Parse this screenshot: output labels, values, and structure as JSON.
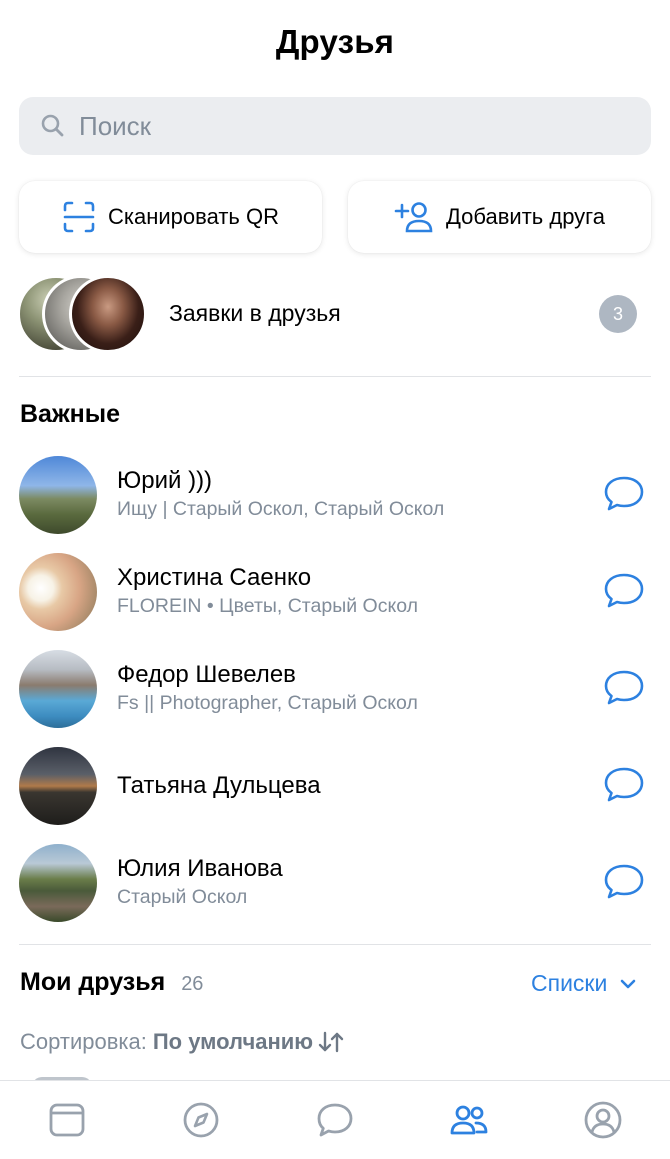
{
  "header": {
    "title": "Друзья"
  },
  "search": {
    "placeholder": "Поиск"
  },
  "actions": {
    "scan_qr": "Сканировать QR",
    "add_friend": "Добавить друга"
  },
  "requests": {
    "label": "Заявки в друзья",
    "count": "3"
  },
  "important": {
    "title": "Важные",
    "friends": [
      {
        "name": "Юрий )))",
        "subtitle": "Ищу | Старый Оскол, Старый Оскол"
      },
      {
        "name": "Христина Саенко",
        "subtitle": "FLOREIN • Цветы, Старый Оскол"
      },
      {
        "name": "Федор Шевелев",
        "subtitle": "Fs || Photographer, Старый Оскол"
      },
      {
        "name": "Татьяна Дульцева",
        "subtitle": ""
      },
      {
        "name": "Юлия Иванова",
        "subtitle": "Старый Оскол"
      }
    ]
  },
  "my_friends": {
    "title": "Мои друзья",
    "count": "26",
    "lists_label": "Списки"
  },
  "sort": {
    "label": "Сортировка:",
    "value": "По умолчанию"
  },
  "colors": {
    "accent": "#2d81e0",
    "secondary_text": "#818c99",
    "search_bg": "#ebedf0",
    "badge": "#aeb7c2"
  },
  "icons": {
    "search": "search-icon",
    "qr": "qr-scan-icon",
    "add": "add-user-icon",
    "message": "message-bubble-icon",
    "chevron": "chevron-down-icon",
    "sort": "sort-arrows-icon",
    "tabs": [
      "newsfeed-icon",
      "compass-icon",
      "message-icon",
      "friends-icon",
      "profile-icon"
    ]
  },
  "tabbar": {
    "active": "friends"
  }
}
